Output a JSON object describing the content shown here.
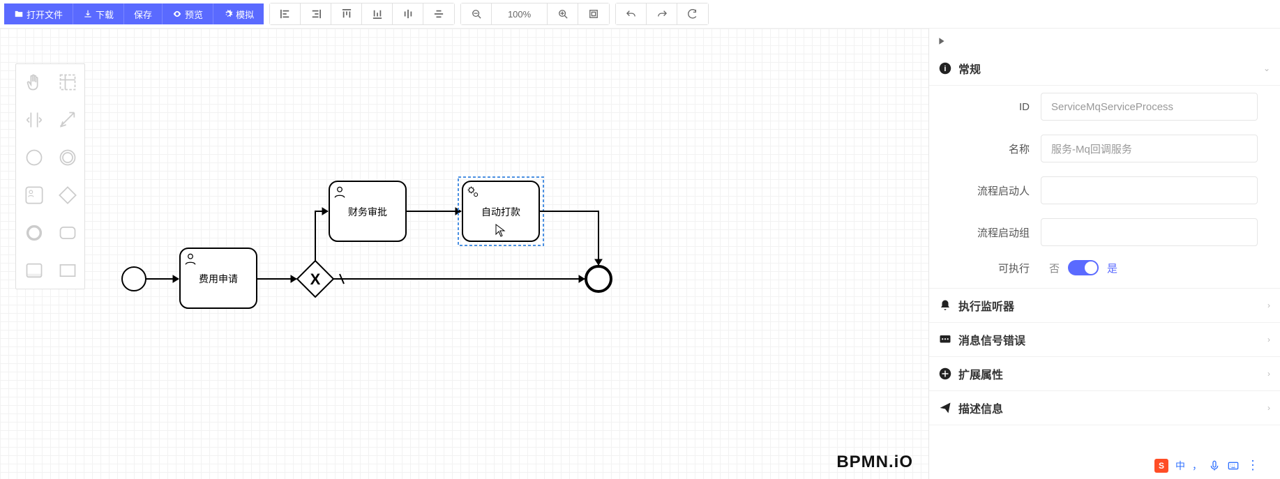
{
  "toolbar": {
    "open_label": "打开文件",
    "download_label": "下载",
    "save_label": "保存",
    "preview_label": "预览",
    "simulate_label": "模拟",
    "zoom_level": "100%"
  },
  "diagram": {
    "tasks": {
      "expense_apply": "费用申请",
      "finance_approve": "财务审批",
      "auto_payment": "自动打款"
    },
    "watermark": "BPMN.iO"
  },
  "panel": {
    "section_general": "常规",
    "field_id_label": "ID",
    "field_id_value": "ServiceMqServiceProcess",
    "field_name_label": "名称",
    "field_name_value": "服务-Mq回调服务",
    "field_starter_label": "流程启动人",
    "field_starter_value": "",
    "field_starter_group_label": "流程启动组",
    "field_starter_group_value": "",
    "field_executable_label": "可执行",
    "switch_off": "否",
    "switch_on": "是",
    "section_listeners": "执行监听器",
    "section_message_error": "消息信号错误",
    "section_extensions": "扩展属性",
    "section_description": "描述信息"
  },
  "ime": {
    "lang": "中",
    "punct": "，"
  }
}
